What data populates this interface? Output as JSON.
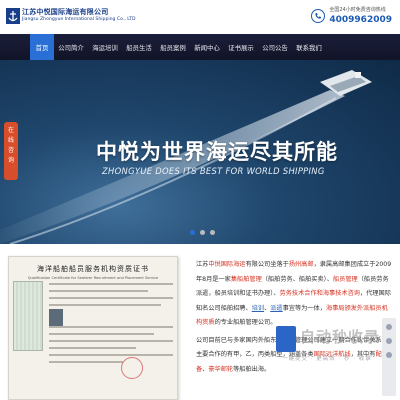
{
  "header": {
    "company_cn": "江苏中悦国际海运有限公司",
    "company_en": "Jiangsu Zhongyue International Shipping Co., LTD",
    "hotline_label": "全国24小时免费咨询热线",
    "hotline_number": "4009962009"
  },
  "nav": {
    "items": [
      {
        "label": "首页",
        "active": true
      },
      {
        "label": "公司简介"
      },
      {
        "label": "海运培训"
      },
      {
        "label": "船员生活"
      },
      {
        "label": "船员案例"
      },
      {
        "label": "新闻中心"
      },
      {
        "label": "证书展示"
      },
      {
        "label": "公司公告"
      },
      {
        "label": "联系我们"
      }
    ]
  },
  "banner": {
    "title": "中悦为世界海运尽其所能",
    "subtitle": "ZHONGYUE DOES ITS BEST FOR WORLD SHIPPING",
    "slides": 3,
    "active_slide": 1
  },
  "side_tab": {
    "chars": [
      "在",
      "线",
      "咨",
      "询"
    ]
  },
  "certificate": {
    "title": "海洋船舶船员服务机构资质证书",
    "subtitle": "Qualification Certificate for Seafarer Recruitment and Placement Service"
  },
  "intro": {
    "p1_a": "江苏",
    "p1_b": "中悦国际海运",
    "p1_c": "有限公司坐落于",
    "p1_d": "扬州高邮",
    "p1_e": "，隶属高邮集团成立于2009年8月是一家",
    "p1_f": "集船舶管理",
    "p1_g": "（船舶劳务、船舶买卖）",
    "p1_h": "、",
    "p1_i": "船员管理",
    "p1_j": "（船员劳务派遣，船员培训和证书办理）",
    "p1_k": "、",
    "p1_l": "劳务技术合作和海事技术咨询",
    "p1_m": "，代理国际知名公司船舶招聘、",
    "p1_n": "培训",
    "p1_o": "、",
    "p1_p": "派遣",
    "p1_q": "事宜等为一体，",
    "p1_r": "海事局颁发外派船员机构资质",
    "p1_s": "的专业船舶管理公司。",
    "p2_a": "公司目前已与多家国内外船东、船舶管理公司建立一期合作伙伴关系，主要合作的有甲，乙，丙类船型",
    "p2_b": "，涵盖各类",
    "p2_c": "国际远洋航线",
    "p2_d": "，其中有",
    "p2_e": "配备",
    "p2_f": "、",
    "p2_g": "豪华邮轮",
    "p2_h": "等船舶出海。"
  },
  "watermark": {
    "text": "自动秒收录",
    "sub": "一键提交 · 更高效 · 秒 · 收录"
  },
  "colors": {
    "brand_blue": "#1c5bb5",
    "nav_bg": "#151833",
    "nav_active": "#2a6fd6",
    "accent_red": "#d6301f",
    "side_tab": "#d84e2a"
  }
}
